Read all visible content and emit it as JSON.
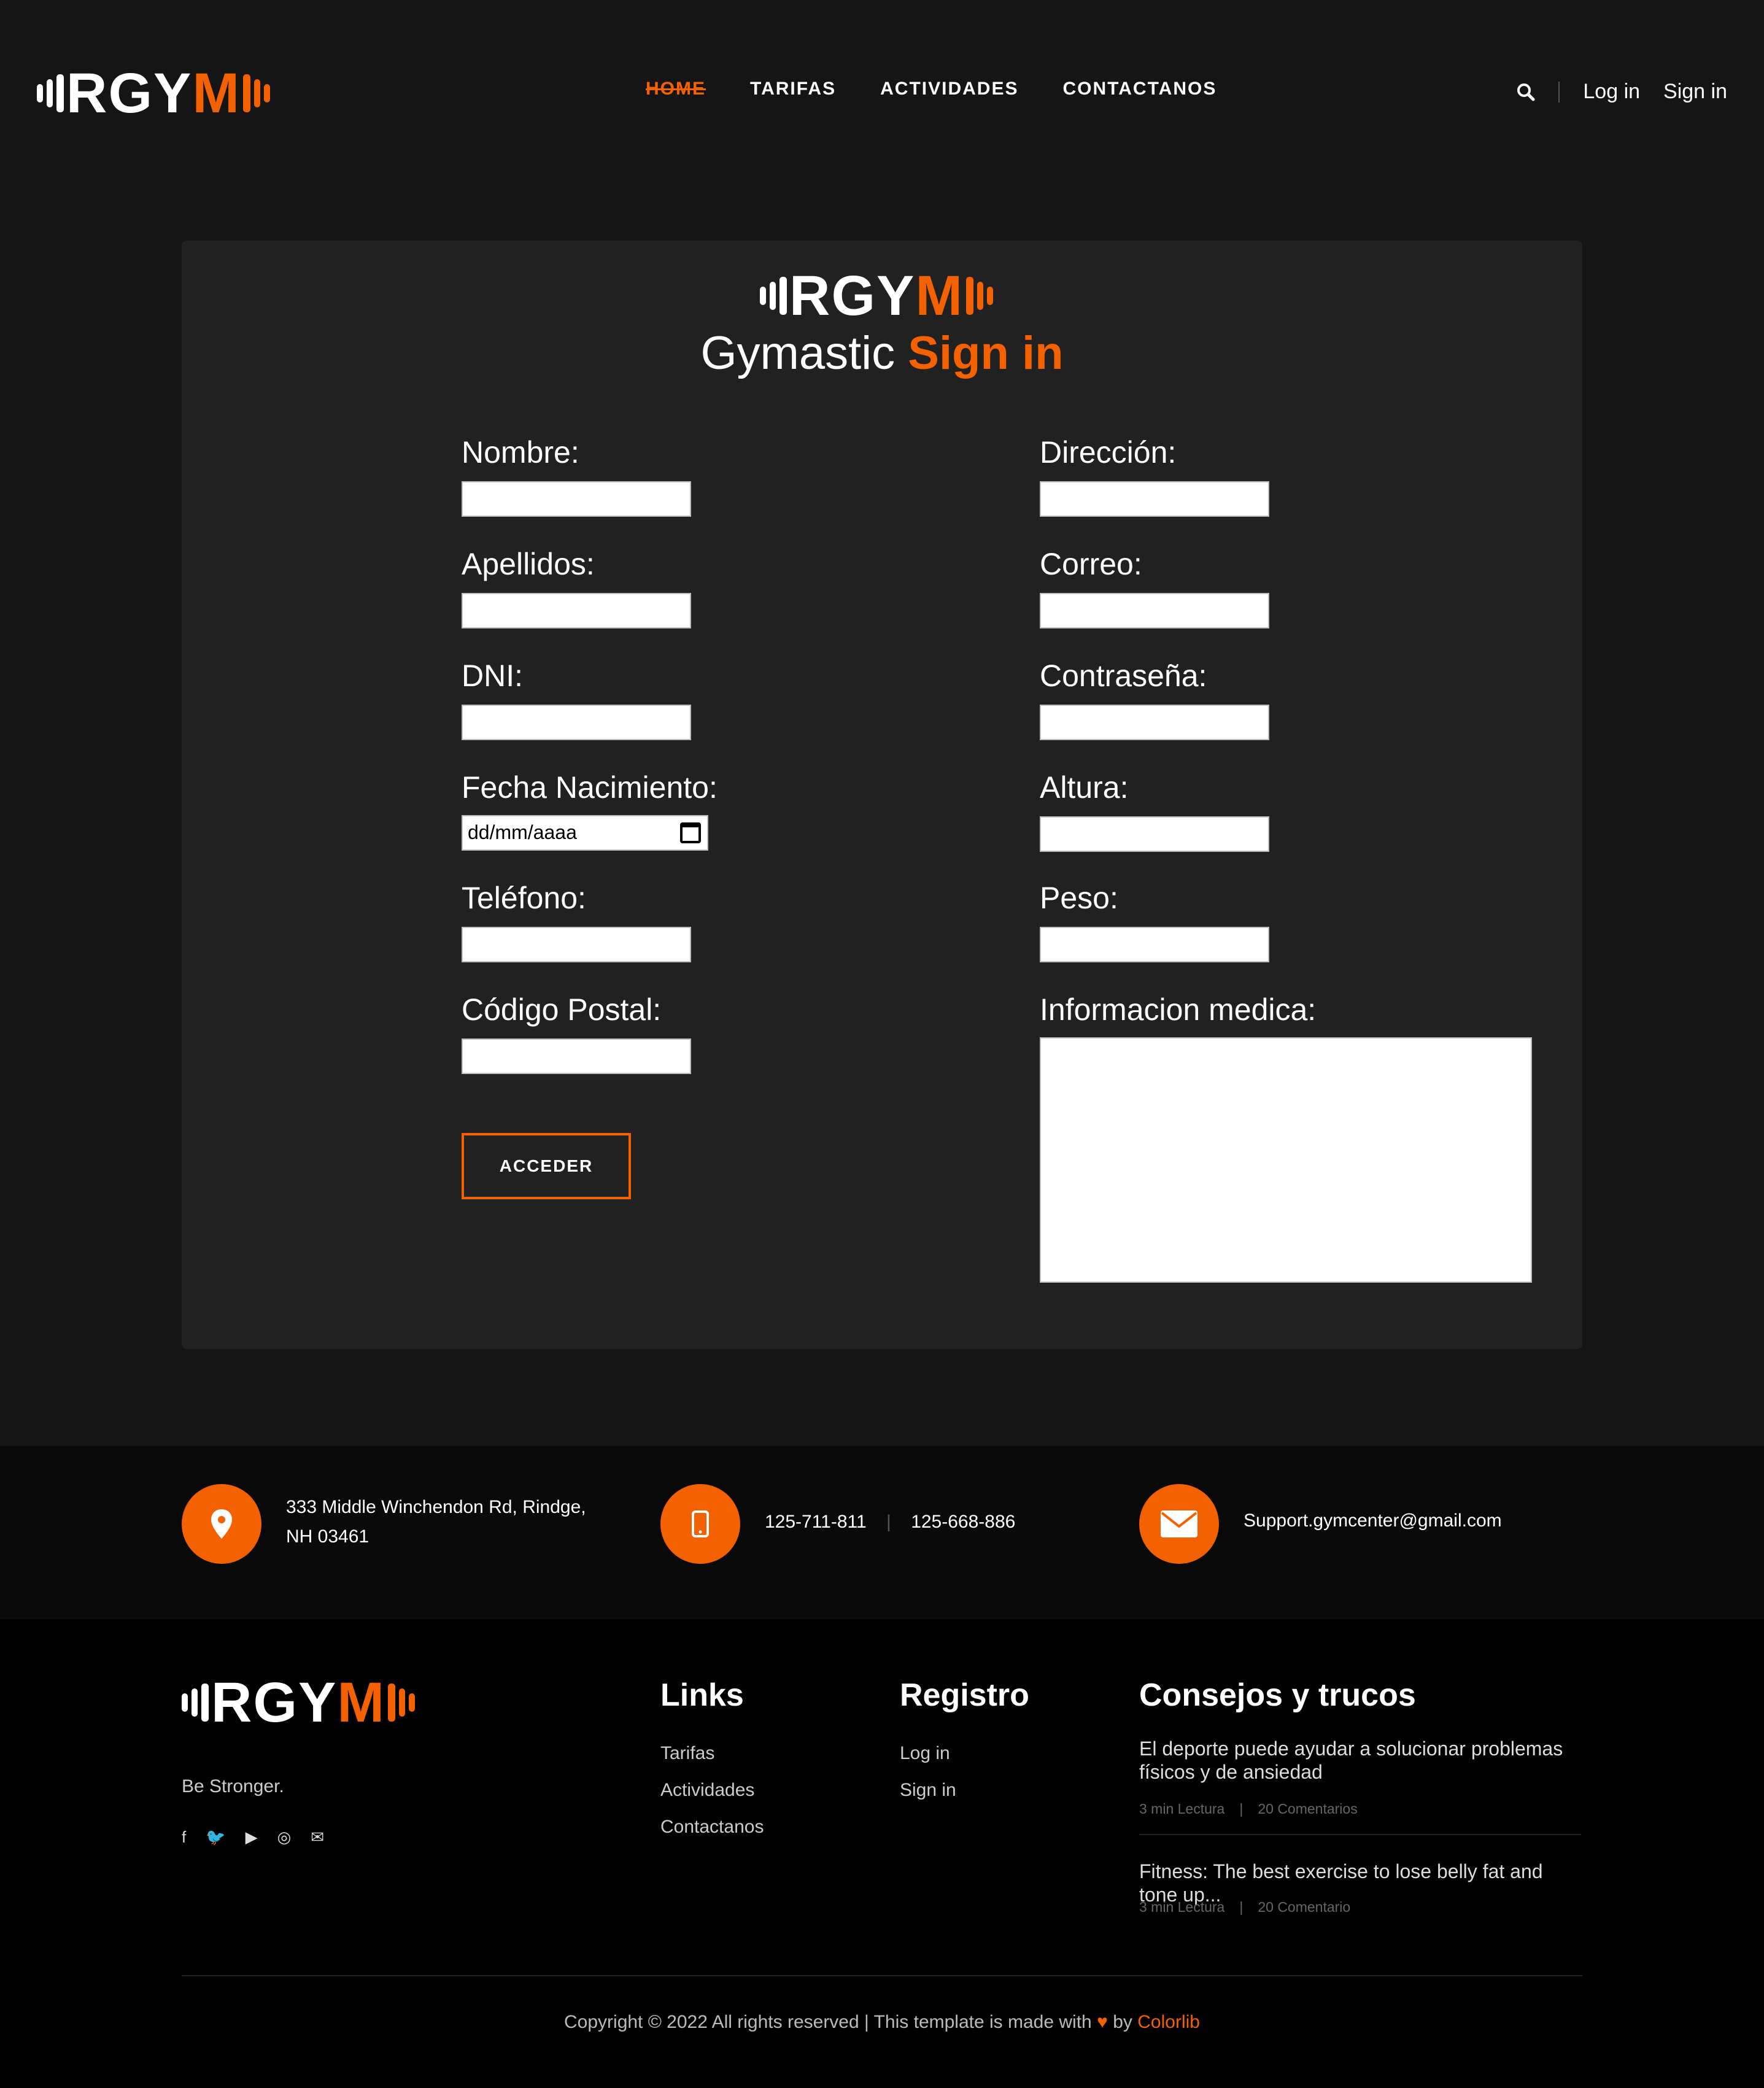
{
  "brand": {
    "white": "RGY",
    "orange": "M",
    "accent": "#f36100"
  },
  "nav": {
    "home": "HOME",
    "tarifas": "TARIFAS",
    "actividades": "ACTIVIDADES",
    "contactanos": "CONTACTANOS"
  },
  "header": {
    "login": "Log in",
    "signin": "Sign in",
    "search_icon": "search-icon"
  },
  "form": {
    "title_white": "Gymastic ",
    "title_orange": "Sign in",
    "nombre": "Nombre:",
    "apellidos": "Apellidos:",
    "dni": "DNI:",
    "fecha": "Fecha Nacimiento:",
    "fecha_placeholder": "dd/mm/aaaa",
    "telefono": "Teléfono:",
    "codigo": "Código Postal:",
    "direccion": "Dirección:",
    "correo": "Correo:",
    "contrasena": "Contraseña:",
    "altura": "Altura:",
    "peso": "Peso:",
    "info": "Informacion medica:",
    "submit": "ACCEDER"
  },
  "contact": {
    "address1": "333 Middle Winchendon Rd, Rindge,",
    "address2": "NH 03461",
    "phone1": "125-711-811",
    "phone2": "125-668-886",
    "email": "Support.gymcenter@gmail.com"
  },
  "footer": {
    "tagline": "Be Stronger.",
    "links_title": "Links",
    "links": [
      "Tarifas",
      "Actividades",
      "Contactanos"
    ],
    "registro_title": "Registro",
    "registro": [
      "Log in",
      "Sign in"
    ],
    "tips_title": "Consejos y trucos",
    "tip1": "El deporte puede ayudar a solucionar problemas físicos y de ansiedad",
    "tip1_meta_a": "3 min Lectura",
    "tip1_meta_b": "20 Comentarios",
    "tip2": "Fitness: The best exercise to lose belly fat and tone up...",
    "tip2_meta_a": "3 min Lectura",
    "tip2_meta_b": "20 Comentario",
    "copyright": "Copyright © 2022 All rights reserved | This template is made with",
    "by": "by",
    "colorlib": "Colorlib"
  }
}
